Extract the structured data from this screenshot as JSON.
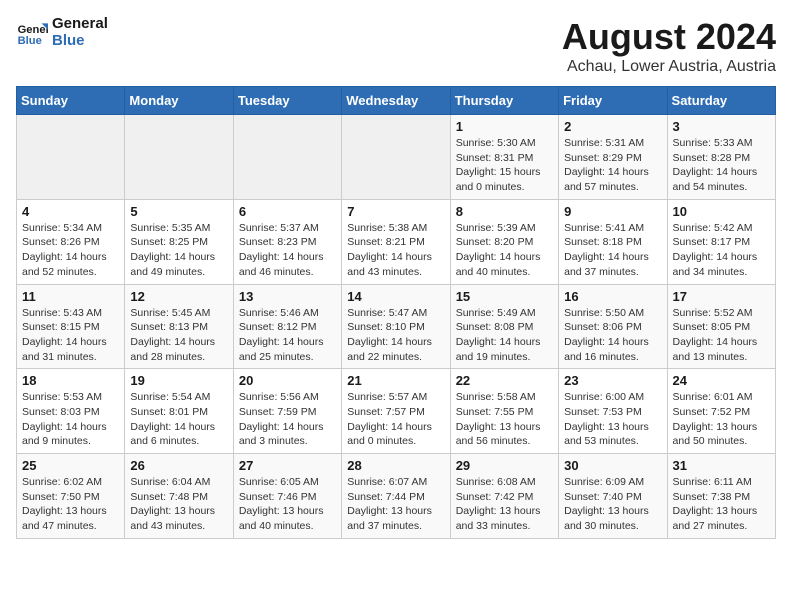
{
  "logo": {
    "line1": "General",
    "line2": "Blue"
  },
  "title": "August 2024",
  "location": "Achau, Lower Austria, Austria",
  "days_of_week": [
    "Sunday",
    "Monday",
    "Tuesday",
    "Wednesday",
    "Thursday",
    "Friday",
    "Saturday"
  ],
  "weeks": [
    [
      {
        "day": "",
        "info": ""
      },
      {
        "day": "",
        "info": ""
      },
      {
        "day": "",
        "info": ""
      },
      {
        "day": "",
        "info": ""
      },
      {
        "day": "1",
        "info": "Sunrise: 5:30 AM\nSunset: 8:31 PM\nDaylight: 15 hours\nand 0 minutes."
      },
      {
        "day": "2",
        "info": "Sunrise: 5:31 AM\nSunset: 8:29 PM\nDaylight: 14 hours\nand 57 minutes."
      },
      {
        "day": "3",
        "info": "Sunrise: 5:33 AM\nSunset: 8:28 PM\nDaylight: 14 hours\nand 54 minutes."
      }
    ],
    [
      {
        "day": "4",
        "info": "Sunrise: 5:34 AM\nSunset: 8:26 PM\nDaylight: 14 hours\nand 52 minutes."
      },
      {
        "day": "5",
        "info": "Sunrise: 5:35 AM\nSunset: 8:25 PM\nDaylight: 14 hours\nand 49 minutes."
      },
      {
        "day": "6",
        "info": "Sunrise: 5:37 AM\nSunset: 8:23 PM\nDaylight: 14 hours\nand 46 minutes."
      },
      {
        "day": "7",
        "info": "Sunrise: 5:38 AM\nSunset: 8:21 PM\nDaylight: 14 hours\nand 43 minutes."
      },
      {
        "day": "8",
        "info": "Sunrise: 5:39 AM\nSunset: 8:20 PM\nDaylight: 14 hours\nand 40 minutes."
      },
      {
        "day": "9",
        "info": "Sunrise: 5:41 AM\nSunset: 8:18 PM\nDaylight: 14 hours\nand 37 minutes."
      },
      {
        "day": "10",
        "info": "Sunrise: 5:42 AM\nSunset: 8:17 PM\nDaylight: 14 hours\nand 34 minutes."
      }
    ],
    [
      {
        "day": "11",
        "info": "Sunrise: 5:43 AM\nSunset: 8:15 PM\nDaylight: 14 hours\nand 31 minutes."
      },
      {
        "day": "12",
        "info": "Sunrise: 5:45 AM\nSunset: 8:13 PM\nDaylight: 14 hours\nand 28 minutes."
      },
      {
        "day": "13",
        "info": "Sunrise: 5:46 AM\nSunset: 8:12 PM\nDaylight: 14 hours\nand 25 minutes."
      },
      {
        "day": "14",
        "info": "Sunrise: 5:47 AM\nSunset: 8:10 PM\nDaylight: 14 hours\nand 22 minutes."
      },
      {
        "day": "15",
        "info": "Sunrise: 5:49 AM\nSunset: 8:08 PM\nDaylight: 14 hours\nand 19 minutes."
      },
      {
        "day": "16",
        "info": "Sunrise: 5:50 AM\nSunset: 8:06 PM\nDaylight: 14 hours\nand 16 minutes."
      },
      {
        "day": "17",
        "info": "Sunrise: 5:52 AM\nSunset: 8:05 PM\nDaylight: 14 hours\nand 13 minutes."
      }
    ],
    [
      {
        "day": "18",
        "info": "Sunrise: 5:53 AM\nSunset: 8:03 PM\nDaylight: 14 hours\nand 9 minutes."
      },
      {
        "day": "19",
        "info": "Sunrise: 5:54 AM\nSunset: 8:01 PM\nDaylight: 14 hours\nand 6 minutes."
      },
      {
        "day": "20",
        "info": "Sunrise: 5:56 AM\nSunset: 7:59 PM\nDaylight: 14 hours\nand 3 minutes."
      },
      {
        "day": "21",
        "info": "Sunrise: 5:57 AM\nSunset: 7:57 PM\nDaylight: 14 hours\nand 0 minutes."
      },
      {
        "day": "22",
        "info": "Sunrise: 5:58 AM\nSunset: 7:55 PM\nDaylight: 13 hours\nand 56 minutes."
      },
      {
        "day": "23",
        "info": "Sunrise: 6:00 AM\nSunset: 7:53 PM\nDaylight: 13 hours\nand 53 minutes."
      },
      {
        "day": "24",
        "info": "Sunrise: 6:01 AM\nSunset: 7:52 PM\nDaylight: 13 hours\nand 50 minutes."
      }
    ],
    [
      {
        "day": "25",
        "info": "Sunrise: 6:02 AM\nSunset: 7:50 PM\nDaylight: 13 hours\nand 47 minutes."
      },
      {
        "day": "26",
        "info": "Sunrise: 6:04 AM\nSunset: 7:48 PM\nDaylight: 13 hours\nand 43 minutes."
      },
      {
        "day": "27",
        "info": "Sunrise: 6:05 AM\nSunset: 7:46 PM\nDaylight: 13 hours\nand 40 minutes."
      },
      {
        "day": "28",
        "info": "Sunrise: 6:07 AM\nSunset: 7:44 PM\nDaylight: 13 hours\nand 37 minutes."
      },
      {
        "day": "29",
        "info": "Sunrise: 6:08 AM\nSunset: 7:42 PM\nDaylight: 13 hours\nand 33 minutes."
      },
      {
        "day": "30",
        "info": "Sunrise: 6:09 AM\nSunset: 7:40 PM\nDaylight: 13 hours\nand 30 minutes."
      },
      {
        "day": "31",
        "info": "Sunrise: 6:11 AM\nSunset: 7:38 PM\nDaylight: 13 hours\nand 27 minutes."
      }
    ]
  ]
}
